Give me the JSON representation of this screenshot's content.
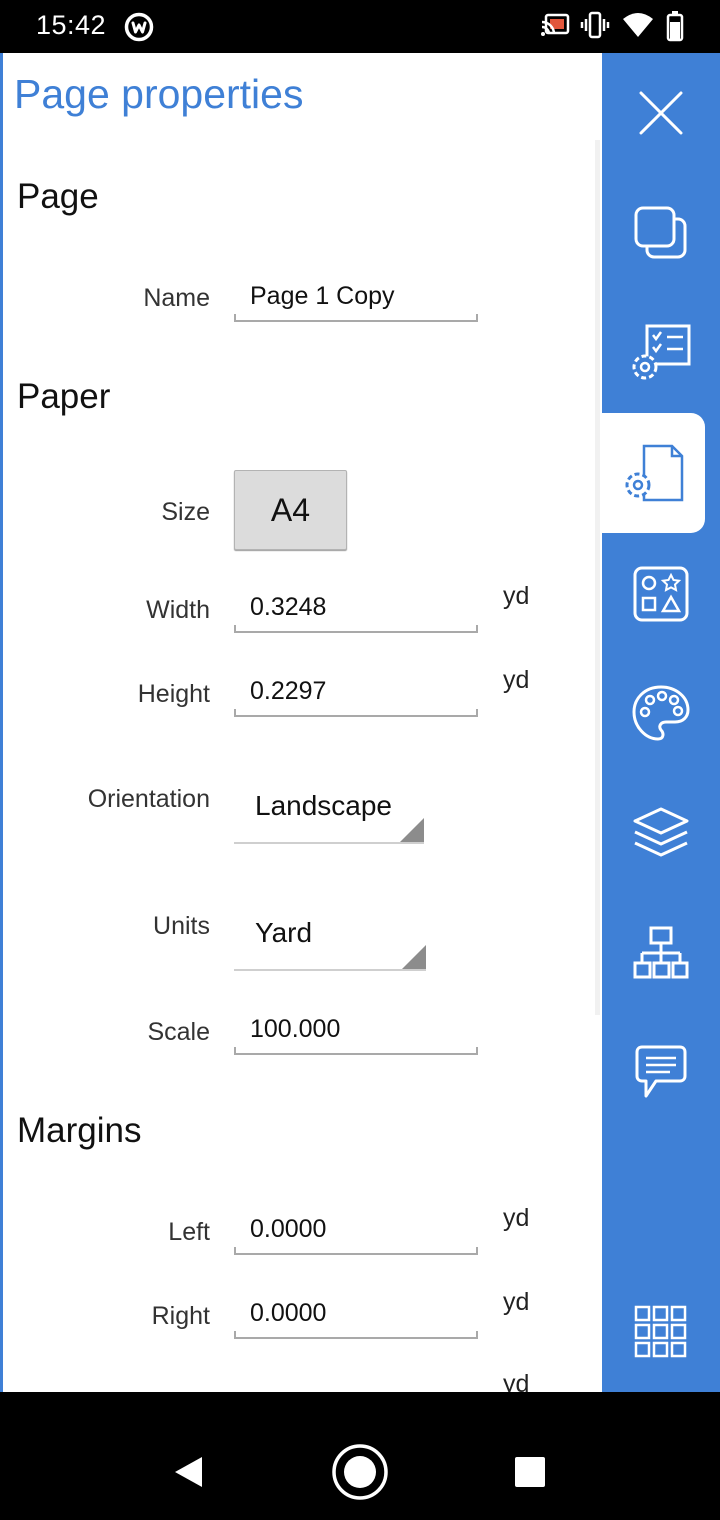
{
  "status_bar": {
    "time": "15:42",
    "app_icon": "at-sign-icon",
    "icons": [
      "cast-icon",
      "vibrate-icon",
      "wifi-icon",
      "battery-icon"
    ]
  },
  "panel": {
    "title": "Page properties",
    "sections": {
      "page": {
        "heading": "Page",
        "name_label": "Name",
        "name_value": "Page 1 Copy"
      },
      "paper": {
        "heading": "Paper",
        "size_label": "Size",
        "size_value": "A4",
        "width_label": "Width",
        "width_value": "0.3248",
        "width_unit": "yd",
        "height_label": "Height",
        "height_value": "0.2297",
        "height_unit": "yd",
        "orientation_label": "Orientation",
        "orientation_value": "Landscape",
        "units_label": "Units",
        "units_value": "Yard",
        "scale_label": "Scale",
        "scale_value": "100.000"
      },
      "margins": {
        "heading": "Margins",
        "left_label": "Left",
        "left_value": "0.0000",
        "left_unit": "yd",
        "right_label": "Right",
        "right_value": "0.0000",
        "right_unit": "yd",
        "top_unit": "yd"
      }
    }
  },
  "toolbar": {
    "accent_color": "#3f80d6",
    "tools": [
      "close-icon",
      "duplicate-icon",
      "settings-checklist-icon",
      "page-settings-icon",
      "shapes-icon",
      "palette-icon",
      "layers-icon",
      "hierarchy-icon",
      "comment-icon",
      "grid-menu-icon"
    ],
    "active_tool": "page-settings-icon"
  },
  "nav_bar": {
    "buttons": [
      "back-icon",
      "home-icon",
      "recents-icon"
    ]
  }
}
